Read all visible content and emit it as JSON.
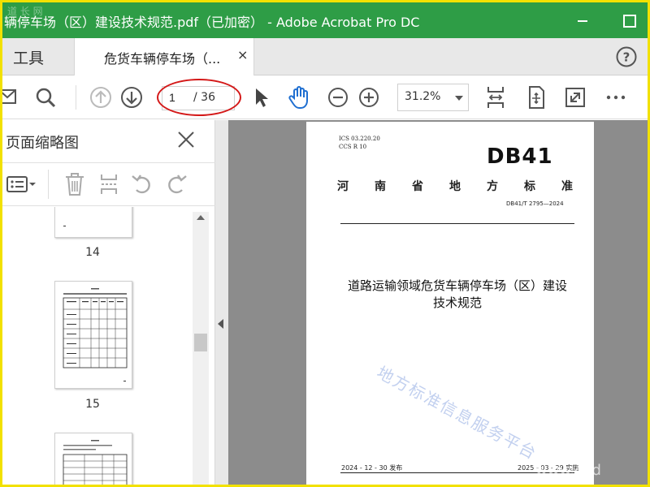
{
  "window": {
    "title": "辆停车场（区）建设技术规范.pdf（已加密） - Adobe Acrobat Pro DC",
    "corner_watermark": "道 长 网"
  },
  "tabs": {
    "tools_label": "工具",
    "document_label": "危货车辆停车场（...",
    "document_close": "×"
  },
  "toolbar": {
    "page_current": "1",
    "page_total": "/ 36",
    "zoom": "31.2%"
  },
  "panel": {
    "title": "页面缩略图",
    "thumbnails": [
      {
        "label": "14"
      },
      {
        "label": "15"
      }
    ]
  },
  "document": {
    "ics_line1": "ICS  03.220.20",
    "ics_line2": "CCS  R 10",
    "logo": "DB41",
    "standard_type": [
      "河",
      "南",
      "省",
      "地",
      "方",
      "标",
      "准"
    ],
    "standard_number": "DB41/T 2795—2024",
    "title_line1": "道路运输领域危货车辆停车场（区）建设",
    "title_line2": "技术规范",
    "publish_date": "2024 - 12 - 30 发布",
    "implement_date": "2025 - 03 - 29 实施",
    "watermark": "地方标准信息服务平台",
    "site_watermark": "www.cnd"
  },
  "colors": {
    "titlebar": "#2e9d46",
    "frame": "#f2e100",
    "annotation": "#d41818",
    "hand_tool": "#1f6fd1"
  }
}
